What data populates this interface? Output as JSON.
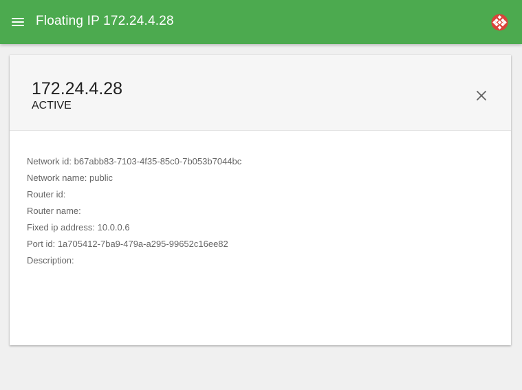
{
  "app_bar": {
    "title": "Floating IP 172.24.4.28",
    "menu_icon": "hamburger-menu-icon",
    "logo_icon": "openstack-logo-icon",
    "background_color": "#4caa4f"
  },
  "card": {
    "title": "172.24.4.28",
    "status": "ACTIVE",
    "close_icon": "close-icon",
    "details": [
      {
        "label": "Network id:",
        "value": "b67abb83-7103-4f35-85c0-7b053b7044bc"
      },
      {
        "label": "Network name:",
        "value": "public"
      },
      {
        "label": "Router id:",
        "value": ""
      },
      {
        "label": "Router name:",
        "value": ""
      },
      {
        "label": "Fixed ip address:",
        "value": "10.0.0.6"
      },
      {
        "label": "Port id:",
        "value": "1a705412-7ba9-479a-a295-99652c16ee82"
      },
      {
        "label": "Description:",
        "value": ""
      }
    ]
  }
}
